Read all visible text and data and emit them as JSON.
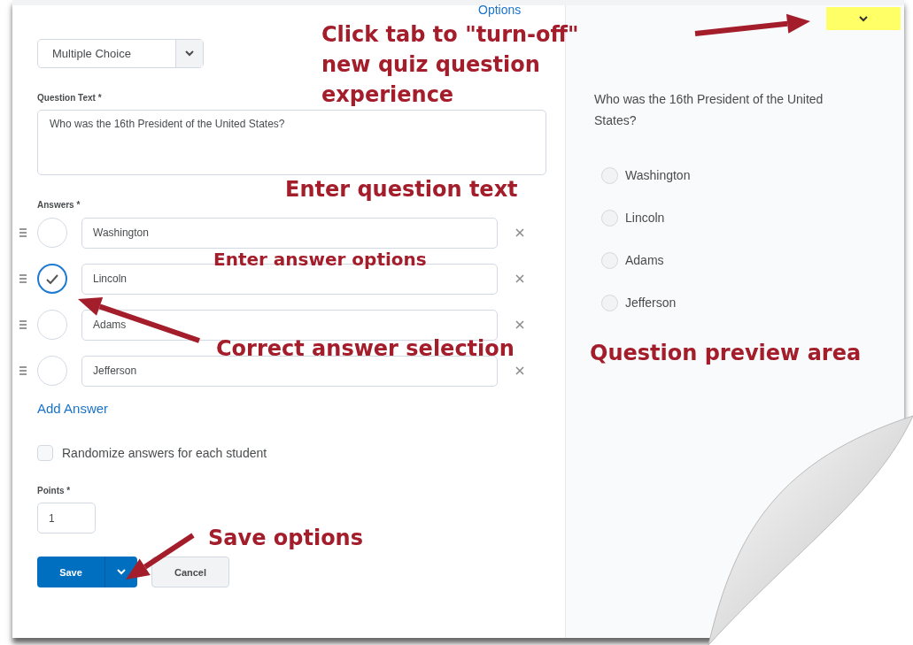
{
  "editor": {
    "question_type": "Multiple Choice",
    "options_link": "Options",
    "question_label": "Question Text *",
    "question_text": "Who was the 16th President of the United States?",
    "answers_label": "Answers *",
    "answers": [
      {
        "text": "Washington",
        "selected": false
      },
      {
        "text": "Lincoln",
        "selected": true
      },
      {
        "text": "Adams",
        "selected": false
      },
      {
        "text": "Jefferson",
        "selected": false
      }
    ],
    "add_answer": "Add Answer",
    "randomize": {
      "label": "Randomize answers for each student",
      "checked": false
    },
    "points_label": "Points *",
    "points": "1",
    "buttons": {
      "save": "Save",
      "cancel": "Cancel"
    }
  },
  "preview": {
    "question": "Who was the 16th President of the United States?",
    "choices": [
      {
        "text": "Washington",
        "selected": false
      },
      {
        "text": "Lincoln",
        "selected": false
      },
      {
        "text": "Adams",
        "selected": false
      },
      {
        "text": "Jefferson",
        "selected": false
      }
    ]
  },
  "annotations": [
    {
      "text": "Click tab to \"turn-off\"\nnew quiz question\nexperience"
    },
    {
      "text": "Enter question text"
    },
    {
      "text": "Enter answer options"
    },
    {
      "text": "Correct answer selection"
    },
    {
      "text": "Question preview area"
    },
    {
      "text": "Save options"
    }
  ]
}
